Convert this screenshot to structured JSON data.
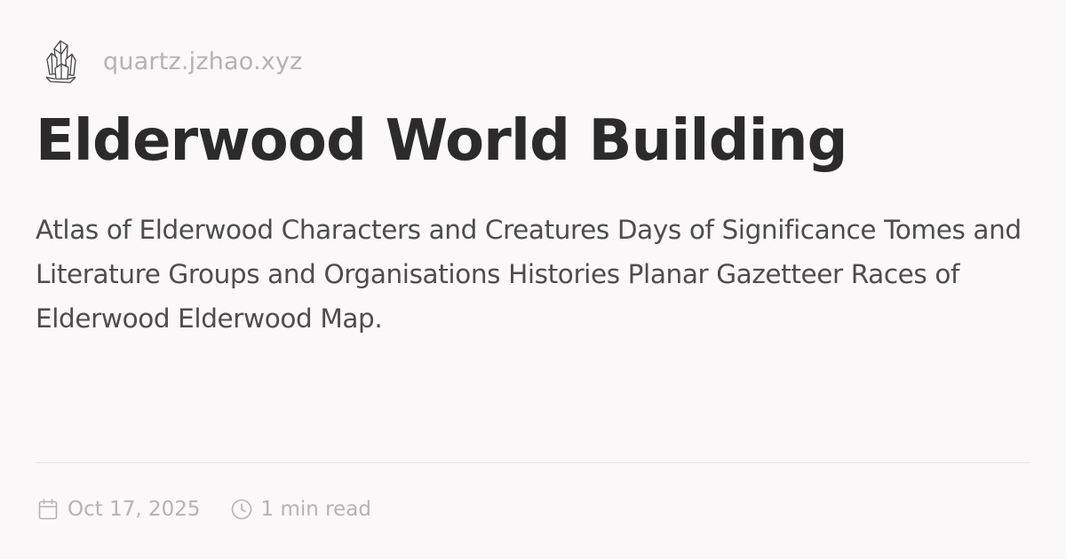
{
  "site": {
    "name": "quartz.jzhao.xyz",
    "logo_icon": "crystal-cluster-icon"
  },
  "page": {
    "title": "Elderwood World Building",
    "description": "Atlas of Elderwood Characters and Creatures Days of Significance Tomes and Literature Groups and Organisations Histories Planar Gazetteer Races of Elderwood Elderwood Map."
  },
  "meta": {
    "date": "Oct 17, 2025",
    "date_icon": "calendar-icon",
    "reading_time": "1 min read",
    "reading_time_icon": "clock-icon"
  },
  "colors": {
    "background": "#faf8f8",
    "title": "#2b2b2b",
    "description": "#4d4d4d",
    "muted": "#b3b3b3",
    "divider": "#e6e4e4"
  }
}
